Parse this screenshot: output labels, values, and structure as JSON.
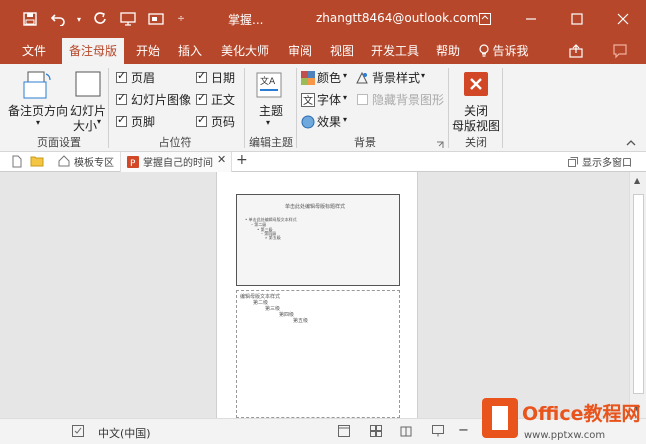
{
  "titlebar": {
    "doc_title": "掌握...",
    "user_email": "zhangtt8464@outlook.com",
    "qat_divider": "÷"
  },
  "tabs": [
    "文件",
    "备注母版",
    "开始",
    "插入",
    "美化大师",
    "审阅",
    "视图",
    "开发工具",
    "帮助",
    "告诉我"
  ],
  "ribbon": {
    "page_setup": {
      "orientation_label": "备注页方向",
      "slide_size_label_1": "幻灯片",
      "slide_size_label_2": "大小",
      "group_label": "页面设置"
    },
    "placeholders": {
      "header": "页眉",
      "slide_image": "幻灯片图像",
      "footer": "页脚",
      "date": "日期",
      "body": "正文",
      "page_number": "页码",
      "group_label": "占位符"
    },
    "edit_theme": {
      "theme_label": "主题",
      "group_label": "编辑主题"
    },
    "background": {
      "colors": "颜色",
      "fonts": "字体",
      "effects": "效果",
      "bg_styles": "背景样式",
      "hide_bg_graphics": "隐藏背景图形",
      "group_label": "背景"
    },
    "close": {
      "label_1": "关闭",
      "label_2": "母版视图",
      "group_label": "关闭"
    }
  },
  "doctabs": {
    "template_zone": "模板专区",
    "document": "掌握自己的时间",
    "show_multi_window": "显示多窗口"
  },
  "slide": {
    "title": "单击此处编辑母版标题样式",
    "bullet_1": "• 单击此处编辑母版文本样式",
    "bullet_2": "– 第二级",
    "bullet_3": "• 第三级",
    "bullet_4": "– 第四级",
    "bullet_5": "» 第五级"
  },
  "notes": {
    "line_1": "编辑母版文本样式",
    "line_2": "第二级",
    "line_3": "第三级",
    "line_4": "第四级",
    "line_5": "第五级"
  },
  "statusbar": {
    "language": "中文(中国)"
  },
  "watermark": {
    "brand": "Office教程网",
    "url": "www.pptxw.com"
  },
  "colors": {
    "accent": "#b7472a",
    "ribbon_bg": "#f3f3f3",
    "workspace_bg": "#e6e6e6"
  }
}
